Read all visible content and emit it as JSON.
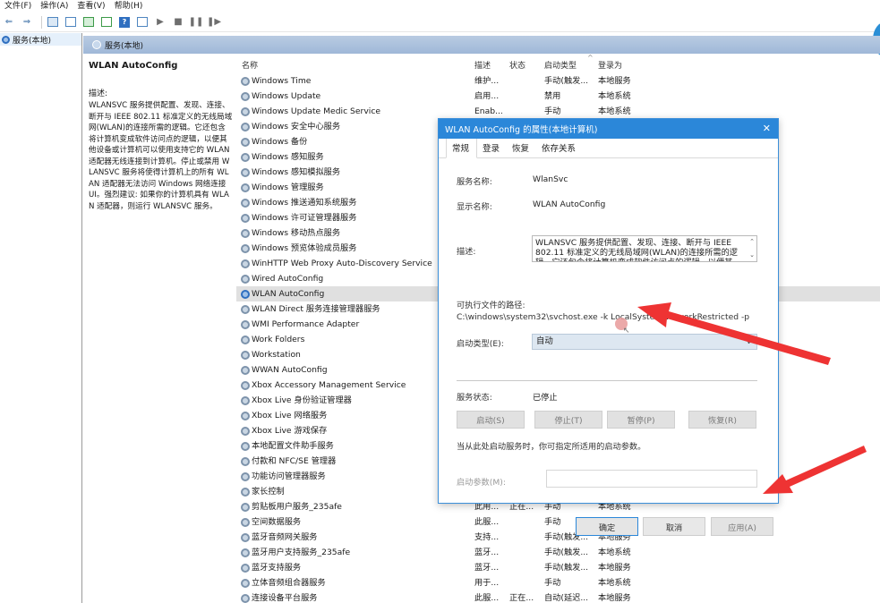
{
  "menu": [
    "文件(F)",
    "操作(A)",
    "查看(V)",
    "帮助(H)"
  ],
  "tree": {
    "root_label": "服务(本地)"
  },
  "panel_header": {
    "title": "服务(本地)"
  },
  "left_desc": {
    "service_name": "WLAN AutoConfig",
    "desc_label": "描述:",
    "desc_text": "WLANSVC 服务提供配置、发现、连接、断开与 IEEE 802.11 标准定义的无线局域网(WLAN)的连接所需的逻辑。它还包含将计算机变成软件访问点的逻辑，以便其他设备或计算机可以使用支持它的 WLAN 适配器无线连接到计算机。停止或禁用 WLANSVC 服务将使得计算机上的所有 WLAN 适配器无法访问 Windows 网络连接 UI。强烈建议: 如果你的计算机具有 WLAN 适配器，则运行 WLANSVC 服务。"
  },
  "columns": {
    "name": "名称",
    "desc": "描述",
    "status": "状态",
    "startup": "启动类型",
    "logon": "登录为"
  },
  "rows": [
    {
      "name": "Windows Time",
      "desc": "维护...",
      "status": "",
      "startup": "手动(触发...",
      "logon": "本地服务"
    },
    {
      "name": "Windows Update",
      "desc": "启用...",
      "status": "",
      "startup": "禁用",
      "logon": "本地系统"
    },
    {
      "name": "Windows Update Medic Service",
      "desc": "Enab...",
      "status": "",
      "startup": "手动",
      "logon": "本地系统"
    },
    {
      "name": "Windows 安全中心服务",
      "desc": "",
      "status": "",
      "startup": "",
      "logon": ""
    },
    {
      "name": "Windows 备份",
      "desc": "",
      "status": "",
      "startup": "",
      "logon": ""
    },
    {
      "name": "Windows 感知服务",
      "desc": "",
      "status": "",
      "startup": "",
      "logon": ""
    },
    {
      "name": "Windows 感知模拟服务",
      "desc": "",
      "status": "",
      "startup": "",
      "logon": ""
    },
    {
      "name": "Windows 管理服务",
      "desc": "",
      "status": "",
      "startup": "",
      "logon": ""
    },
    {
      "name": "Windows 推送通知系统服务",
      "desc": "",
      "status": "",
      "startup": "",
      "logon": ""
    },
    {
      "name": "Windows 许可证管理器服务",
      "desc": "",
      "status": "",
      "startup": "",
      "logon": ""
    },
    {
      "name": "Windows 移动热点服务",
      "desc": "",
      "status": "",
      "startup": "",
      "logon": ""
    },
    {
      "name": "Windows 预览体验成员服务",
      "desc": "",
      "status": "",
      "startup": "",
      "logon": ""
    },
    {
      "name": "WinHTTP Web Proxy Auto-Discovery Service",
      "desc": "",
      "status": "",
      "startup": "",
      "logon": ""
    },
    {
      "name": "Wired AutoConfig",
      "desc": "",
      "status": "",
      "startup": "",
      "logon": ""
    },
    {
      "name": "WLAN AutoConfig",
      "desc": "",
      "status": "",
      "startup": "",
      "logon": "",
      "selected": true
    },
    {
      "name": "WLAN Direct 服务连接管理器服务",
      "desc": "",
      "status": "",
      "startup": "",
      "logon": ""
    },
    {
      "name": "WMI Performance Adapter",
      "desc": "",
      "status": "",
      "startup": "",
      "logon": ""
    },
    {
      "name": "Work Folders",
      "desc": "",
      "status": "",
      "startup": "",
      "logon": ""
    },
    {
      "name": "Workstation",
      "desc": "",
      "status": "",
      "startup": "",
      "logon": ""
    },
    {
      "name": "WWAN AutoConfig",
      "desc": "",
      "status": "",
      "startup": "",
      "logon": ""
    },
    {
      "name": "Xbox Accessory Management Service",
      "desc": "",
      "status": "",
      "startup": "",
      "logon": ""
    },
    {
      "name": "Xbox Live 身份验证管理器",
      "desc": "",
      "status": "",
      "startup": "",
      "logon": ""
    },
    {
      "name": "Xbox Live 网络服务",
      "desc": "",
      "status": "",
      "startup": "",
      "logon": ""
    },
    {
      "name": "Xbox Live 游戏保存",
      "desc": "",
      "status": "",
      "startup": "",
      "logon": ""
    },
    {
      "name": "本地配置文件助手服务",
      "desc": "",
      "status": "",
      "startup": "",
      "logon": ""
    },
    {
      "name": "付款和 NFC/SE 管理器",
      "desc": "",
      "status": "",
      "startup": "",
      "logon": ""
    },
    {
      "name": "功能访问管理器服务",
      "desc": "",
      "status": "",
      "startup": "",
      "logon": ""
    },
    {
      "name": "家长控制",
      "desc": "",
      "status": "",
      "startup": "",
      "logon": ""
    },
    {
      "name": "剪贴板用户服务_235afe",
      "desc": "此用...",
      "status": "正在...",
      "startup": "手动",
      "logon": "本地系统"
    },
    {
      "name": "空间数据服务",
      "desc": "此服...",
      "status": "",
      "startup": "手动",
      "logon": "本地服务"
    },
    {
      "name": "蓝牙音频网关服务",
      "desc": "支持...",
      "status": "",
      "startup": "手动(触发...",
      "logon": "本地服务"
    },
    {
      "name": "蓝牙用户支持服务_235afe",
      "desc": "蓝牙...",
      "status": "",
      "startup": "手动(触发...",
      "logon": "本地系统"
    },
    {
      "name": "蓝牙支持服务",
      "desc": "蓝牙...",
      "status": "",
      "startup": "手动(触发...",
      "logon": "本地服务"
    },
    {
      "name": "立体音频组合器服务",
      "desc": "用于...",
      "status": "",
      "startup": "手动",
      "logon": "本地系统"
    },
    {
      "name": "连接设备平台服务",
      "desc": "此服...",
      "status": "正在...",
      "startup": "自动(延迟...",
      "logon": "本地服务"
    }
  ],
  "dialog": {
    "title": "WLAN AutoConfig 的属性(本地计算机)",
    "close_glyph": "✕",
    "tabs": [
      "常规",
      "登录",
      "恢复",
      "依存关系"
    ],
    "service_name_label": "服务名称:",
    "service_name_value": "WlanSvc",
    "display_name_label": "显示名称:",
    "display_name_value": "WLAN AutoConfig",
    "desc_label": "描述:",
    "desc_value": "WLANSVC 服务提供配置、发现、连接、断开与 IEEE 802.11 标准定义的无线局域网(WLAN)的连接所需的逻辑。它还包含将计算机变成软件访问点的逻辑，以便其...",
    "path_label": "可执行文件的路径:",
    "path_value": "C:\\windows\\system32\\svchost.exe -k LocalSystemNetworkRestricted -p",
    "startup_label": "启动类型(E):",
    "startup_value": "自动",
    "status_label": "服务状态:",
    "status_value": "已停止",
    "btn_start": "启动(S)",
    "btn_stop": "停止(T)",
    "btn_pause": "暂停(P)",
    "btn_resume": "恢复(R)",
    "hint": "当从此处启动服务时，你可指定所适用的启动参数。",
    "param_label": "启动参数(M):",
    "btn_ok": "确定",
    "btn_cancel": "取消",
    "btn_apply": "应用(A)"
  },
  "colors": {
    "accent": "#2b87d9",
    "arrow": "#ee3333"
  }
}
